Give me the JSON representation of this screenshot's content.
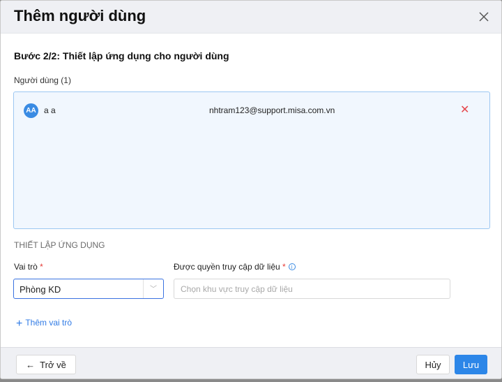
{
  "dialog": {
    "title": "Thêm người dùng",
    "step": "Bước 2/2: Thiết lập ứng dụng cho người dùng"
  },
  "users": {
    "label": "Người dùng (1)",
    "items": [
      {
        "initials": "AA",
        "name": "a a",
        "email": "nhtram123@support.misa.com.vn"
      }
    ]
  },
  "app_setup": {
    "section": "THIẾT LẬP ỨNG DỤNG",
    "role_label": "Vai trò",
    "role_value": "Phòng KD",
    "access_label": "Được quyền truy cập dữ liệu",
    "access_placeholder": "Chọn khu vực truy cập dữ liệu",
    "required_mark": "*",
    "add_role": "Thêm vai trò"
  },
  "footer": {
    "back": "Trở về",
    "cancel": "Hủy",
    "save": "Lưu"
  }
}
